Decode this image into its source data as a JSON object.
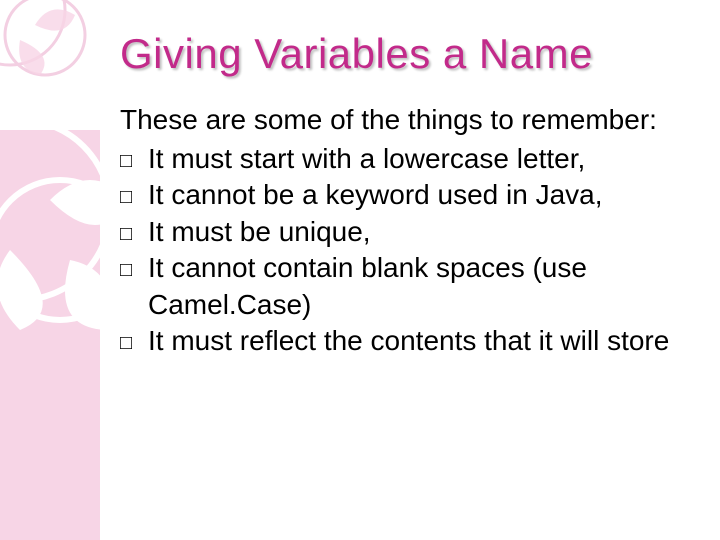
{
  "title": "Giving Variables a Name",
  "intro": "These are some of the things to remember:",
  "bullets": [
    "It must start with a lowercase letter,",
    "It cannot be a keyword used in Java,",
    "It must be unique,",
    "It cannot contain blank spaces (use Camel.Case)",
    "It must reflect the contents that it will store"
  ]
}
